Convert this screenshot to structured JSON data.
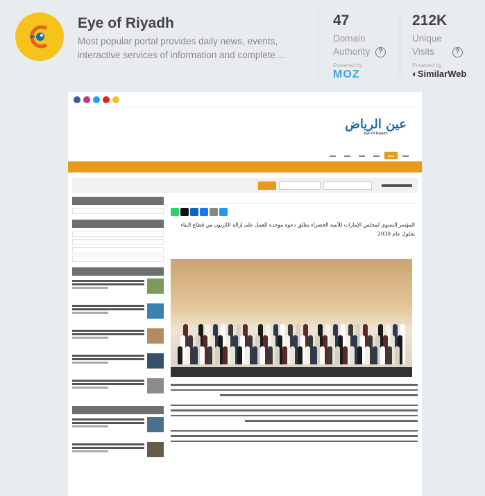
{
  "site": {
    "title": "Eye of Riyadh",
    "description": "Most popular portal provides daily news, events, interactive services of information and complete…"
  },
  "stats": [
    {
      "value": "47",
      "label_line1": "Domain",
      "label_line2": "Authority",
      "powered_label": "Powered by",
      "provider": "MOZ"
    },
    {
      "value": "212K",
      "label_line1": "Unique",
      "label_line2": "Visits",
      "powered_label": "Powered by",
      "provider": "SimilarWeb"
    }
  ],
  "help_icon": "question-circle-icon",
  "preview": {
    "brand_arabic": "عين الرياض",
    "brand_english": "Eye Of Riyadh",
    "headline": "المؤتمر السنوي لمجلس الإمارات للأبنية الخضراء يطلق دعوة موحدة للعمل على إزالة الكربون من قطاع البناء بحلول عام 2030",
    "nav_active_color": "#e89a1c",
    "accent": "#e89a1c"
  }
}
